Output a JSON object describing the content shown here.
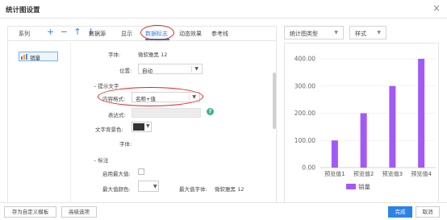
{
  "dialog": {
    "title": "统计图设置",
    "close_glyph": "×"
  },
  "tabs": [
    {
      "label": "系列"
    },
    {
      "label": "数据源"
    },
    {
      "label": "显示"
    },
    {
      "label": "数据标志"
    },
    {
      "label": "动态效果"
    },
    {
      "label": "参考线"
    }
  ],
  "series_toolbar": {
    "icons": "+ − ↑ ↓"
  },
  "series_list": [
    {
      "label": "销量"
    }
  ],
  "label_props": {
    "font_label": "字体:",
    "font_value": "微软雅黑 12",
    "position_label": "位置:",
    "position_value": "自动"
  },
  "tooltip_section": {
    "title": "提示文字",
    "format_label": "内容格式:",
    "format_value": "名称+值",
    "expr_label": "表达式:",
    "help_glyph": "?",
    "bg_label": "文字背景色:",
    "font_label": "字体:"
  },
  "marker_section": {
    "title": "标注",
    "enable_max_label": "启用最大值:",
    "max_color_label": "最大值颜色:",
    "max_font_label": "最大值字体:",
    "max_font_value": "微软雅黑 12"
  },
  "right_toolbar": {
    "chart_type_label": "统计图类型",
    "style_label": "样式"
  },
  "chart_data": {
    "type": "bar",
    "categories": [
      "预览值1",
      "预览值2",
      "预览值3",
      "预览值4"
    ],
    "series": [
      {
        "name": "销量",
        "values": [
          100,
          200,
          300,
          400
        ]
      }
    ],
    "yticks": [
      "0.00",
      "100.00",
      "200.00",
      "300.00",
      "400.00"
    ],
    "ylim": [
      0,
      400
    ],
    "bar_color": "#a259f7",
    "legend_position": "bottom"
  },
  "bottom": {
    "save_template": "存为自定义模板",
    "advanced": "高级选项",
    "done": "完成",
    "cancel": "取消"
  },
  "colors": {
    "accent": "#2b83e5",
    "highlight_ring": "#e0251b",
    "bar": "#a259f7"
  }
}
